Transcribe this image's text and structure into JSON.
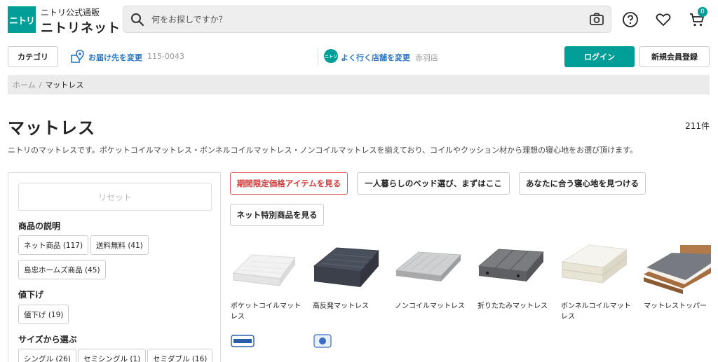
{
  "header": {
    "logo_mark": "ニトリ",
    "logo_sub": "ニトリ公式通販",
    "logo_main": "ニトリネット",
    "search_placeholder": "何をお探しですか？",
    "cart_count": "0"
  },
  "subheader": {
    "category_label": "カテゴリ",
    "delivery_link": "お届け先を変更",
    "postal_code": "115-0043",
    "store_logo": "ニトリ",
    "store_link": "よく行く店舗を変更",
    "store_name": "赤羽店",
    "login_label": "ログイン",
    "register_label": "新規会員登録"
  },
  "breadcrumb": {
    "home": "ホーム",
    "separator": "/",
    "current": "マットレス"
  },
  "page": {
    "title": "マットレス",
    "count": "211件",
    "description": "ニトリのマットレスです。ポケットコイルマットレス・ボンネルコイルマットレス・ノンコイルマットレスを揃えており、コイルやクッション材から理想の寝心地をお選び頂けます。"
  },
  "filters": {
    "reset_label": "リセット",
    "groups": [
      {
        "heading": "商品の説明",
        "chips": [
          "ネット商品 (117)",
          "送料無料 (41)",
          "島忠ホームズ商品 (45)"
        ]
      },
      {
        "heading": "値下げ",
        "chips": [
          "値下げ (19)"
        ]
      },
      {
        "heading": "サイズから選ぶ",
        "chips": [
          "シングル (26)",
          "セミシングル (1)",
          "セミダブル (16)"
        ]
      }
    ]
  },
  "feature_buttons": [
    "期間限定価格アイテムを見る",
    "一人暮らしのベッド選び、まずはここ",
    "あなたに合う寝心地を見つける",
    "ネット特別商品を見る"
  ],
  "products": [
    {
      "label": "ポケットコイルマットレス"
    },
    {
      "label": "高反発マットレス"
    },
    {
      "label": "ノンコイルマットレス"
    },
    {
      "label": "折りたたみマットレス"
    },
    {
      "label": "ボンネルコイルマットレス"
    },
    {
      "label": "マットレストッパー"
    }
  ],
  "colors": {
    "brand": "#009e96",
    "link": "#2b77c6",
    "sale": "#d23c3c"
  },
  "icons": [
    "search-icon",
    "camera-icon",
    "help-icon",
    "heart-icon",
    "cart-icon",
    "location-icon"
  ]
}
